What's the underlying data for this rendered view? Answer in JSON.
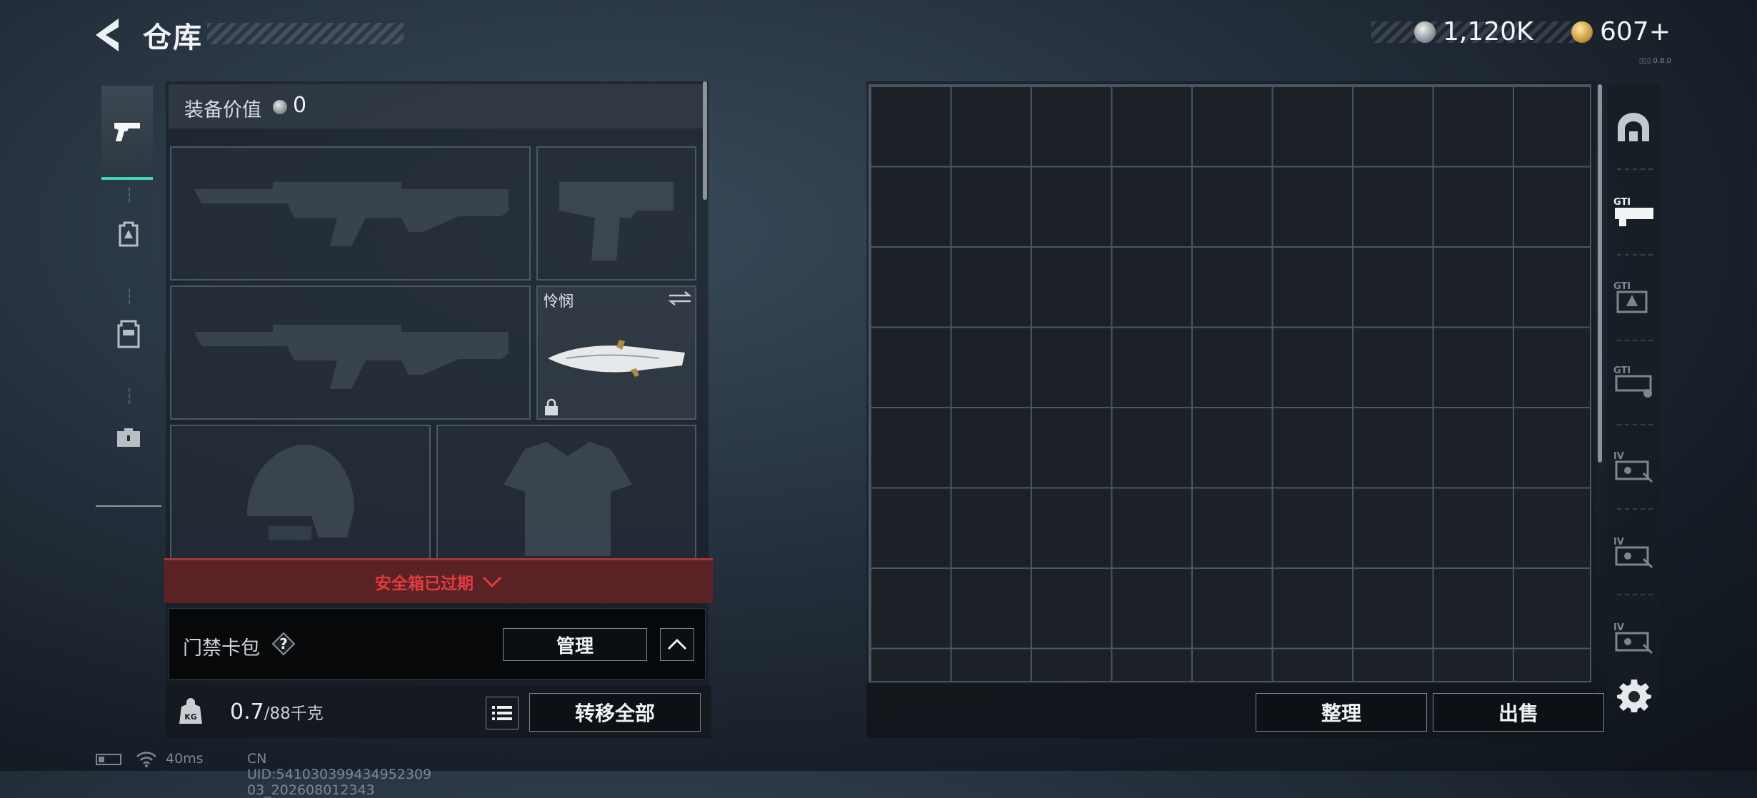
{
  "header": {
    "title": "仓库"
  },
  "currency": {
    "silver_amount": "1,120K",
    "gold_amount": "607+"
  },
  "version_tag": "▯▯▯ 0.8.0",
  "left_tabs": [
    {
      "icon": "pistol-icon",
      "active": true
    },
    {
      "icon": "backpack-icon",
      "active": false
    },
    {
      "icon": "vest-icon",
      "active": false
    },
    {
      "icon": "briefcase-icon",
      "active": false
    }
  ],
  "equipment": {
    "value_label": "装备价值",
    "value_amount": "0",
    "slots": {
      "primary": {
        "icon": "assault-rifle-icon"
      },
      "pistol": {
        "icon": "pistol-icon"
      },
      "secondary": {
        "icon": "assault-rifle-icon"
      },
      "melee": {
        "name": "怜悯",
        "icon": "knife-icon",
        "locked": true
      },
      "helmet": {
        "icon": "helmet-icon"
      },
      "armor": {
        "icon": "body-armor-icon"
      }
    }
  },
  "safebox": {
    "text": "安全箱已过期"
  },
  "card_pack": {
    "label": "门禁卡包",
    "help": "?",
    "manage_label": "管理"
  },
  "weight": {
    "current": "0.7",
    "max": "/88千克"
  },
  "actions": {
    "transfer_all_label": "转移全部",
    "sort_label": "整理",
    "sell_label": "出售"
  },
  "right_tabs": [
    {
      "icon": "safe-vault-icon"
    },
    {
      "icon": "container-gti-icon"
    },
    {
      "icon": "container-gti-2-icon"
    },
    {
      "icon": "container-gti-3-icon"
    },
    {
      "icon": "container-iv-icon"
    },
    {
      "icon": "container-iv-2-icon"
    },
    {
      "icon": "container-iv-3-icon"
    }
  ],
  "status": {
    "ping": "40ms",
    "uid": "CN UID:541030399434952309 03_202608012343"
  }
}
